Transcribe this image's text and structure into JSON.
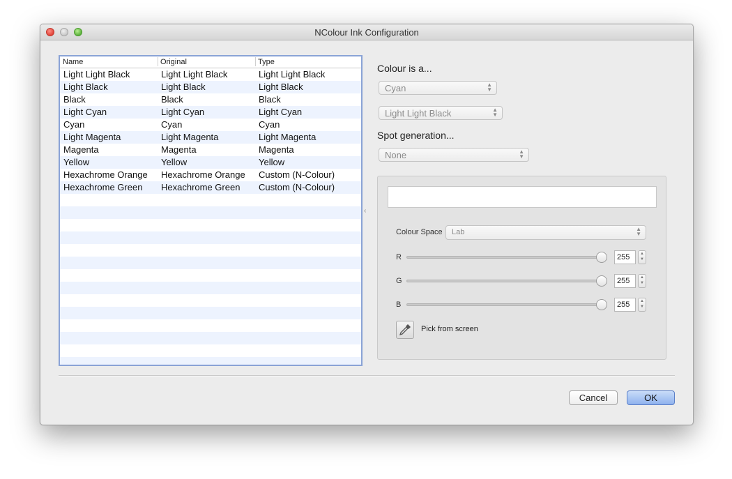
{
  "window": {
    "title": "NColour Ink Configuration"
  },
  "table": {
    "headers": [
      "Name",
      "Original",
      "Type"
    ],
    "rows": [
      [
        "Light Light Black",
        "Light Light Black",
        "Light Light Black"
      ],
      [
        "Light Black",
        "Light Black",
        "Light Black"
      ],
      [
        "Black",
        "Black",
        "Black"
      ],
      [
        "Light Cyan",
        "Light Cyan",
        "Light Cyan"
      ],
      [
        "Cyan",
        "Cyan",
        "Cyan"
      ],
      [
        "Light Magenta",
        "Light Magenta",
        "Light Magenta"
      ],
      [
        "Magenta",
        "Magenta",
        "Magenta"
      ],
      [
        "Yellow",
        "Yellow",
        "Yellow"
      ],
      [
        "Hexachrome Orange",
        "Hexachrome Orange",
        "Custom (N-Colour)"
      ],
      [
        "Hexachrome Green",
        "Hexachrome Green",
        "Custom (N-Colour)"
      ]
    ]
  },
  "panel": {
    "colour_is_label": "Colour is a...",
    "colour_type_value": "Cyan",
    "colour_ink_value": "Light Light Black",
    "spot_label": "Spot generation...",
    "spot_value": "None"
  },
  "colour_editor": {
    "swatch_color": "#ffffff",
    "space_label": "Colour Space",
    "space_value": "Lab",
    "channels": [
      {
        "label": "R",
        "value": "255",
        "level": 1.0
      },
      {
        "label": "G",
        "value": "255",
        "level": 1.0
      },
      {
        "label": "B",
        "value": "255",
        "level": 1.0
      }
    ],
    "pick_label": "Pick from screen",
    "pick_icon": "eyedropper-icon"
  },
  "buttons": {
    "cancel": "Cancel",
    "ok": "OK"
  },
  "colors": {
    "selection_border": "#8aa3d6",
    "stripe": "#edf3fe",
    "default_button": "#8fb2ee"
  }
}
